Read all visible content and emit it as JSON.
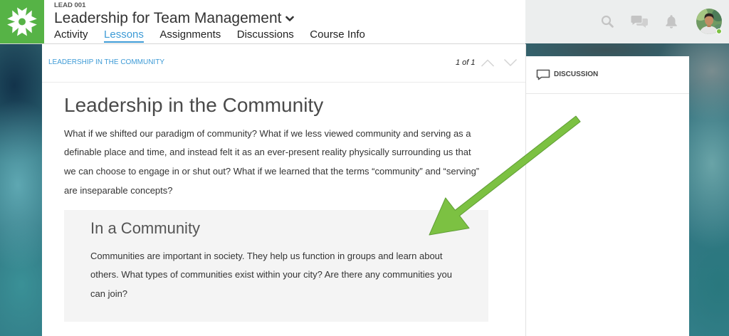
{
  "header": {
    "logo_icon": "asterisk-logo-icon",
    "course_code": "LEAD 001",
    "course_title": "Leadership for Team Management",
    "course_menu_icon": "chevron-down-icon",
    "tabs": [
      {
        "label": "Activity",
        "active": false
      },
      {
        "label": "Lessons",
        "active": true
      },
      {
        "label": "Assignments",
        "active": false
      },
      {
        "label": "Discussions",
        "active": false
      },
      {
        "label": "Course Info",
        "active": false
      }
    ],
    "action_icons": [
      "search-icon",
      "chat-icon",
      "bell-icon"
    ],
    "avatar": {
      "icon": "user-avatar-icon",
      "online": true
    }
  },
  "lesson": {
    "breadcrumb": "LEADERSHIP IN THE COMMUNITY",
    "pager": "1 of 1",
    "prev_icon": "chevron-up-icon",
    "next_icon": "chevron-down-icon",
    "title": "Leadership in the Community",
    "body": "What if we shifted our paradigm of community? What if we less viewed community and serving as a definable place and time, and instead felt it as an ever-present reality physically surrounding us that we can choose to engage in or shut out? What if we learned that the terms “community” and “serving” are inseparable concepts?",
    "callout": {
      "heading": "In a Community",
      "body": "Communities are important in society. They help us function in groups and learn about others. What types of communities exist within your city? Are there any communities you can join?"
    }
  },
  "side_panel": {
    "icon": "discussion-icon",
    "label": "DISCUSSION"
  },
  "annotation": {
    "icon": "annotation-arrow-icon",
    "color": "#7cc142"
  },
  "colors": {
    "brand_green": "#56b346",
    "link_blue": "#3e9bd6",
    "text": "#333333"
  }
}
